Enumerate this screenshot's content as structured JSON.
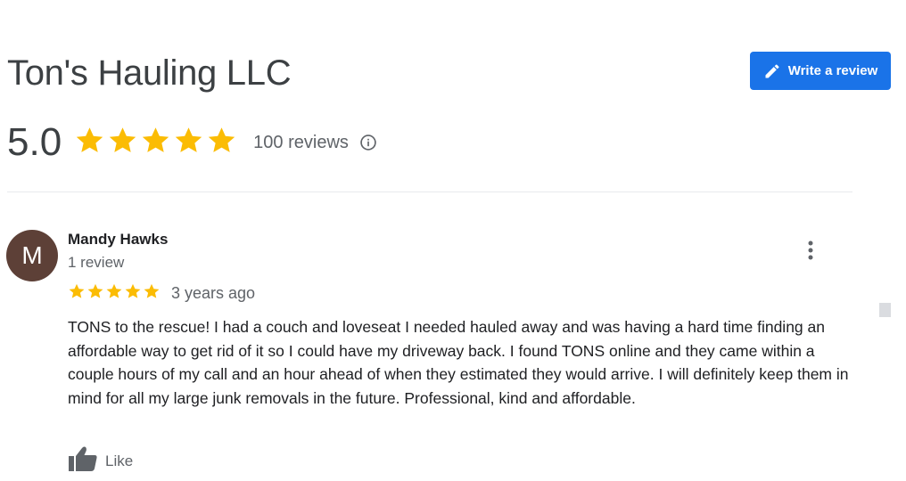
{
  "business": {
    "name": "Ton's Hauling LLC",
    "rating": "5.0",
    "review_count": "100 reviews",
    "star_count": 5,
    "star_color": "#fbbc04"
  },
  "actions": {
    "write_review_label": "Write a review",
    "write_review_icon": "pencil-icon",
    "info_icon": "info-icon"
  },
  "colors": {
    "primary": "#1a73e8",
    "avatar_bg": "#5d4037",
    "text_secondary": "#5f6368"
  },
  "reviews": [
    {
      "author": "Mandy Hawks",
      "avatar_letter": "M",
      "author_meta": "1 review",
      "rating": 5,
      "time": "3 years ago",
      "text": "TONS to the rescue! I had a couch and loveseat I needed hauled away and was having a hard time finding an affordable way to get rid of it so I could have my driveway back.  I found TONS online and they came within a couple hours of my call and an hour ahead of when they estimated they would arrive. I will definitely keep them in mind for all my large junk removals in the future. Professional, kind and affordable.",
      "like_label": "Like"
    }
  ]
}
